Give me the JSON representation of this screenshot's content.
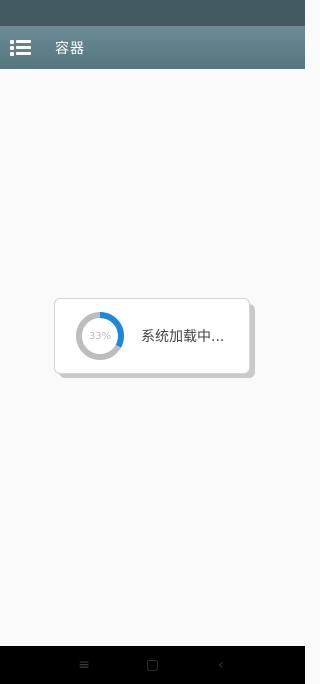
{
  "app_bar": {
    "title": "容器",
    "menu_icon": "list-menu-icon",
    "color": "#5f808b"
  },
  "loading": {
    "progress_percent": 33,
    "progress_label": "33%",
    "message": "系统加载中...",
    "progress_color": "#1e88d8",
    "track_color": "#bdbdbd"
  },
  "nav_bar": {
    "menu_icon": "≡",
    "home_icon": "▢",
    "back_icon": "‹"
  }
}
